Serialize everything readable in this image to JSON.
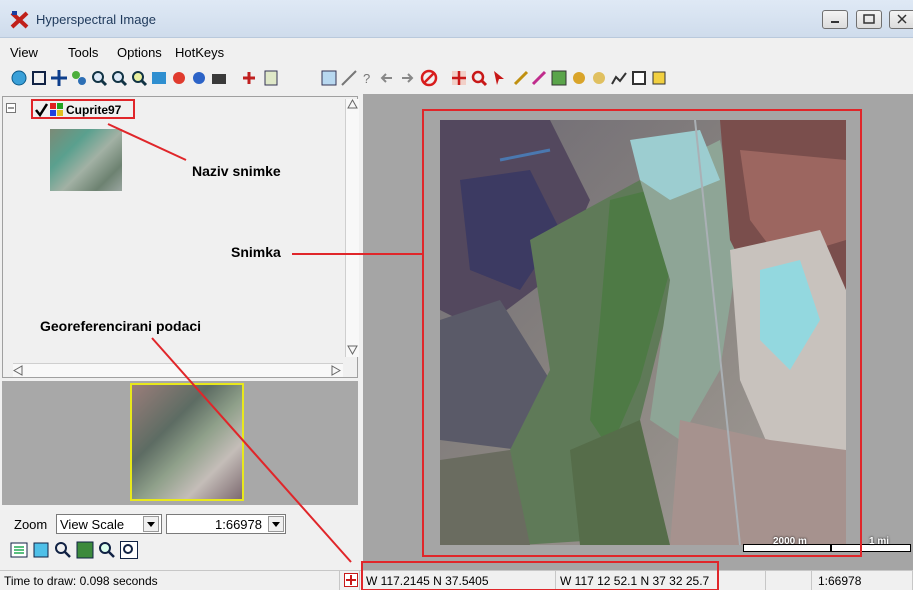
{
  "window": {
    "title": "Hyperspectral Image"
  },
  "menu": [
    "View",
    "Tools",
    "Options",
    "HotKeys"
  ],
  "layers": [
    {
      "name": "Cuprite97",
      "checked": true
    }
  ],
  "annotations": {
    "layer_name": "Naziv snimke",
    "image": "Snimka",
    "georef": "Georeferencirani podaci"
  },
  "zoom": {
    "label": "Zoom",
    "mode": "View Scale",
    "scale": "1:66978"
  },
  "scalebar": {
    "left_label": "2000 m",
    "right_label": "1 mi"
  },
  "status": {
    "time": "Time to draw: 0.098 seconds",
    "decimal_coords": "W 117.2145  N 37.5405",
    "dms_coords": "W 117 12 52.1  N 37 32 25.7",
    "blank": "",
    "scale": "1:66978"
  },
  "colors": {
    "annotation_red": "#e0262a",
    "overview_frame": "#e8e81c",
    "titlebar": "#cfdcec"
  }
}
